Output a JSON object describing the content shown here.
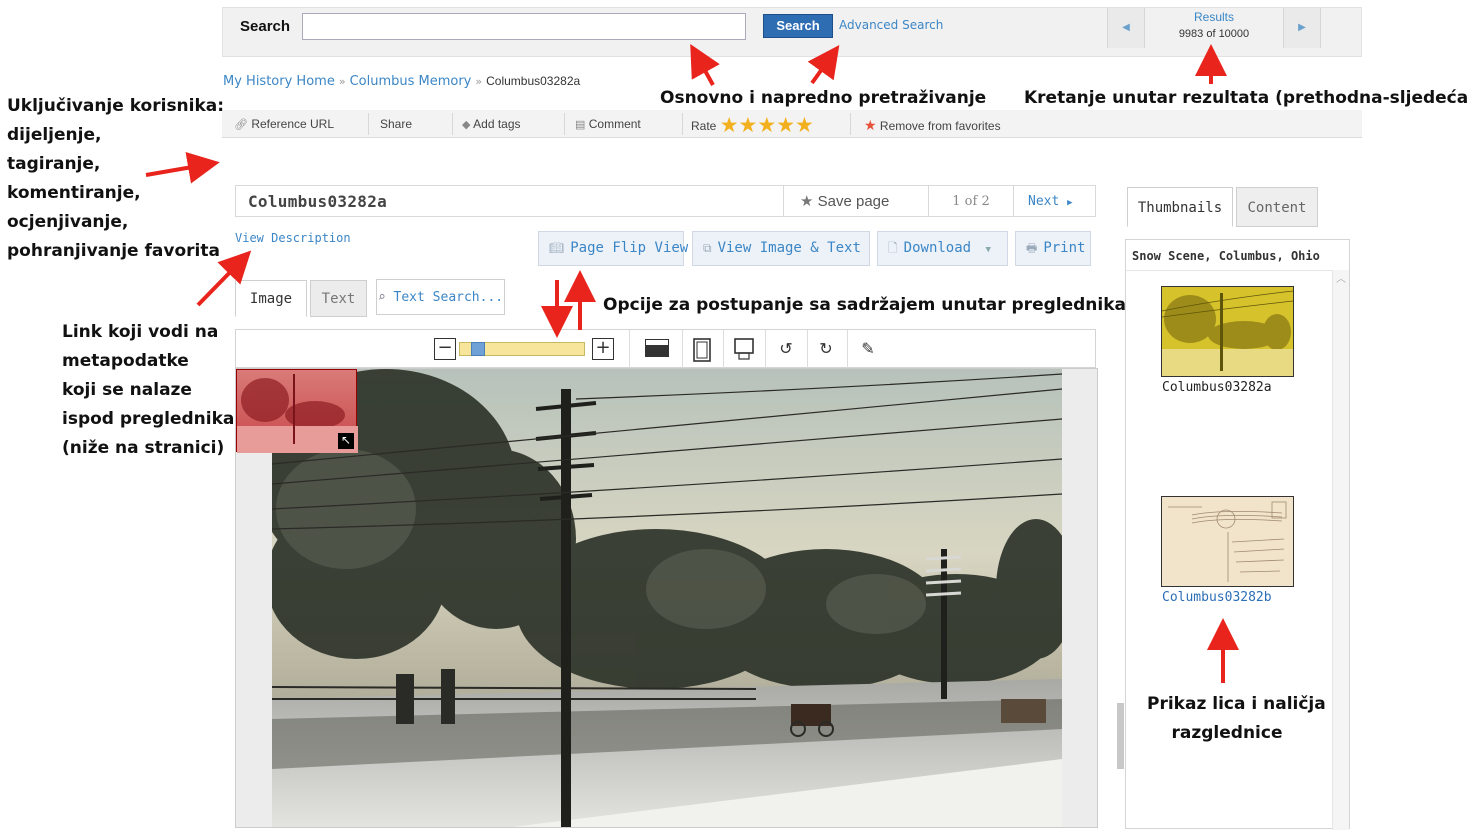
{
  "search": {
    "label": "Search",
    "input_value": "",
    "button": "Search",
    "advanced": "Advanced Search"
  },
  "results": {
    "title": "Results",
    "count": "9983  of 10000",
    "prev_icon": "triangle-left-icon",
    "next_icon": "triangle-right-icon"
  },
  "breadcrumb": {
    "items": [
      "My History Home",
      "Columbus Memory"
    ],
    "separator": "»",
    "current": "Columbus03282a"
  },
  "actions": {
    "reference_url": "Reference URL",
    "share": "Share",
    "add_tags": "Add tags",
    "comment": "Comment",
    "rate": "Rate",
    "rating_stars": 5,
    "remove_favorites": "Remove from favorites"
  },
  "item": {
    "title": "Columbus03282a",
    "save_page": "Save page",
    "page_count": "1 of 2",
    "next": "Next",
    "view_description": "View Description"
  },
  "view_buttons": {
    "page_flip": "Page Flip View",
    "view_image_text": "View Image & Text",
    "download": "Download",
    "print": "Print"
  },
  "viewer_tabs": {
    "image": "Image",
    "text": "Text",
    "text_search": "Text Search..."
  },
  "viewer_tools": [
    "zoom-out-icon",
    "zoom-slider",
    "zoom-in-icon",
    "background-toggle-icon",
    "fit-page-icon",
    "fit-width-icon",
    "rotate-left-icon",
    "rotate-right-icon",
    "annotate-pencil-icon"
  ],
  "zoom_level": 0.1,
  "sidebar": {
    "tabs": [
      "Thumbnails",
      "Content"
    ],
    "title": "Snow Scene, Columbus, Ohio",
    "thumbnails": [
      {
        "label": "Columbus03282a",
        "selected": true
      },
      {
        "label": "Columbus03282b",
        "selected": false
      }
    ]
  },
  "annotations": {
    "search": "Osnovno i napredno pretraživanje",
    "results_nav": "Kretanje unutar rezultata (prethodna-sljedeća)",
    "user_inclusion": [
      "Uključivanje korisnika:",
      "dijeljenje,",
      "tagiranje,",
      "komentiranje,",
      "ocjenjivanje,",
      "pohranjivanje favorita"
    ],
    "metadata_link": [
      "Link koji vodi na",
      "metapodatke",
      "koji se nalaze",
      "ispod preglednika",
      "(niže na stranici)"
    ],
    "viewer_options": "Opcije za postupanje sa sadržajem unutar preglednika",
    "postcard": [
      "Prikaz lica i naličja",
      "razglednice"
    ]
  },
  "colors": {
    "accent": "#3b86c6",
    "search_button": "#2f6db2",
    "star": "#f2b01e",
    "arrow": "#e8241c"
  }
}
